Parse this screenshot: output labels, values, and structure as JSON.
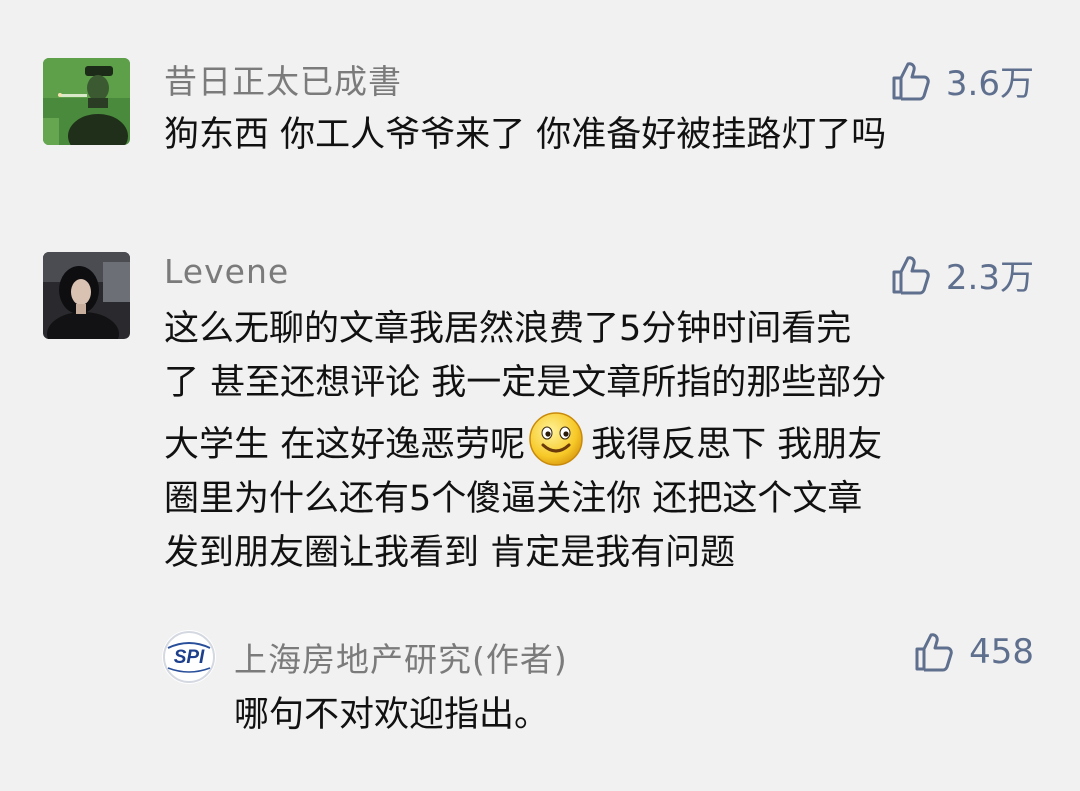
{
  "comments": [
    {
      "username": "昔日正太已成書",
      "likes": "3.6万",
      "avatar": "avatar-soldier-smoking",
      "text_lines": [
        "狗东西 你工人爷爷来了 你准备好被挂路灯了吗"
      ]
    },
    {
      "username": "Levene",
      "likes": "2.3万",
      "avatar": "avatar-woman-dark-hair",
      "text_lines": [
        "这么无聊的文章我居然浪费了5分钟时间看完",
        "了 甚至还想评论 我一定是文章所指的那些部分",
        "大学生 在这好逸恶劳呢",
        "我得反思下 我朋友",
        "圈里为什么还有5个傻逼关注你 还把这个文章",
        "发到朋友圈让我看到 肯定是我有问题"
      ],
      "emoji": "smiley-emoji"
    }
  ],
  "reply": {
    "username": "上海房地产研究(作者)",
    "likes": "458",
    "avatar": "spi-logo",
    "avatar_text": "SPI",
    "text": "哪句不对欢迎指出。"
  },
  "colors": {
    "background": "#f1f1f1",
    "username": "#7b7b7b",
    "like": "#5f6f8e",
    "text": "#111111"
  }
}
